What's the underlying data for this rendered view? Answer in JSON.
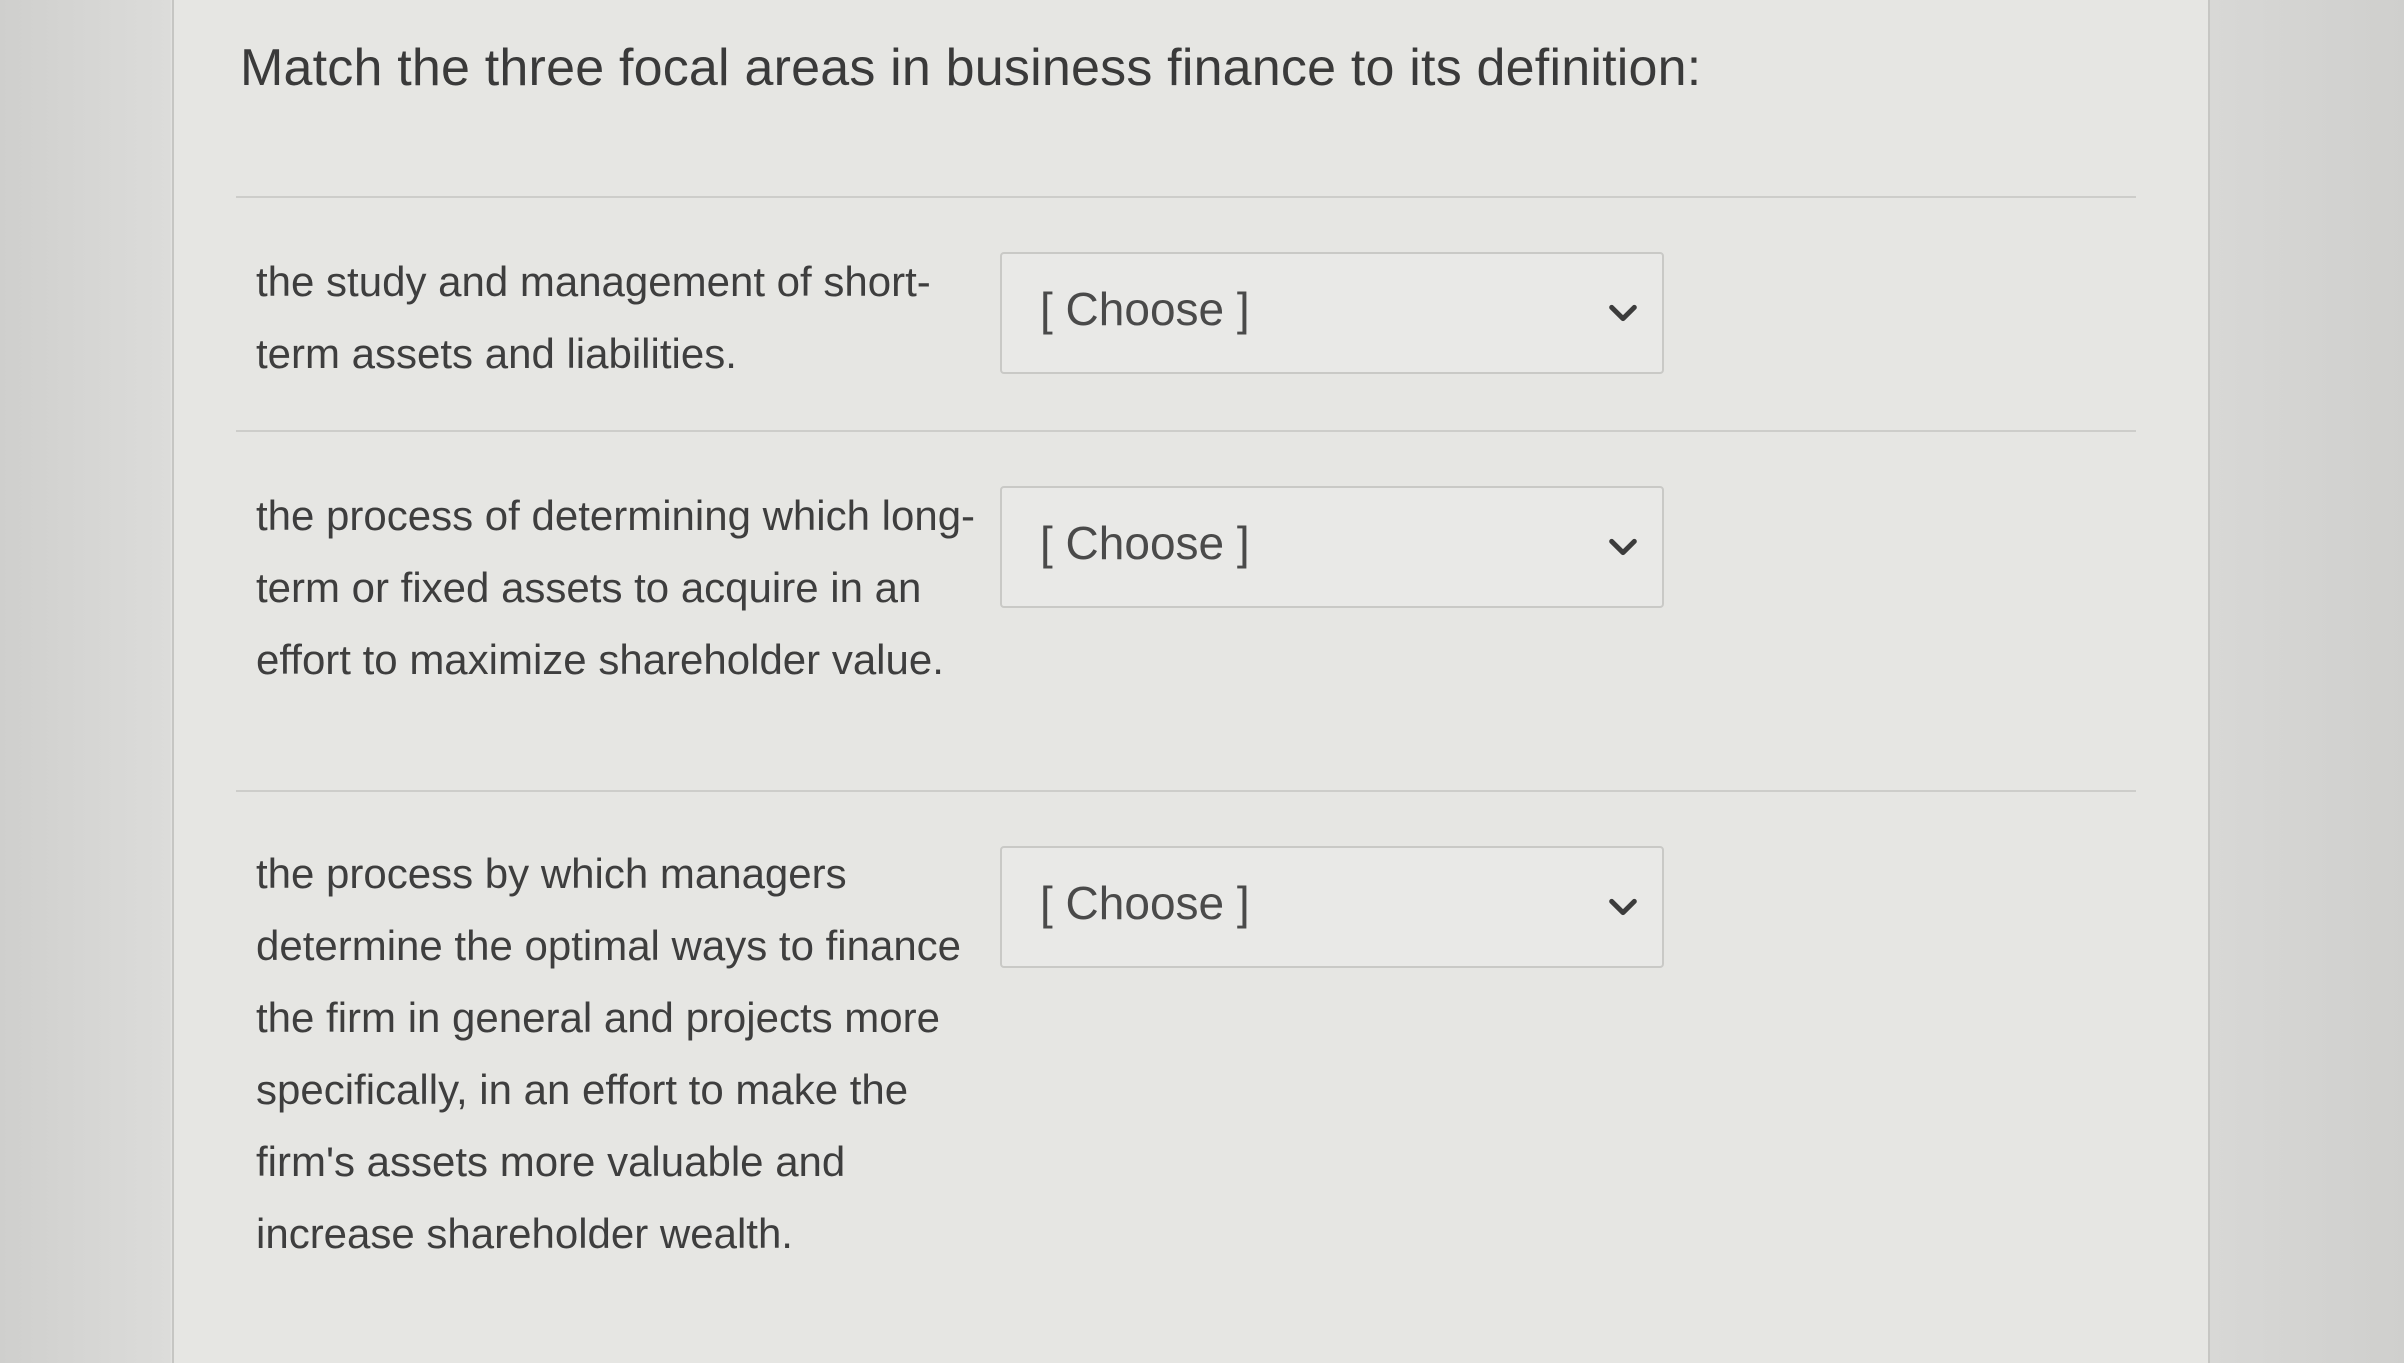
{
  "question": {
    "title": "Match the three focal areas in business finance to its definition:"
  },
  "matches": [
    {
      "prompt": "the study and management of short-term assets and liabilities.",
      "selected": "[ Choose ]"
    },
    {
      "prompt": "the process of determining which long-term or fixed assets to acquire in an effort to maximize shareholder value.",
      "selected": "[ Choose ]"
    },
    {
      "prompt": "the process by which managers determine the optimal ways to finance the firm in general and projects more specifically, in an effort to make the firm's assets more valuable and increase shareholder wealth.",
      "selected": "[ Choose ]"
    }
  ],
  "icons": {
    "dropdown": "chevron-down-icon"
  }
}
